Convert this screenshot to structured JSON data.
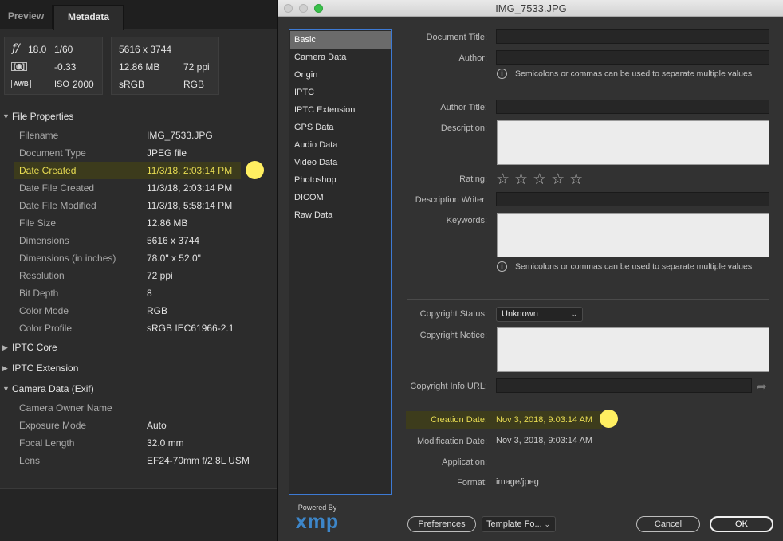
{
  "left_panel": {
    "tabs": [
      "Preview",
      "Metadata"
    ],
    "camera_summary": {
      "aperture_glyph": "f/",
      "aperture": "18.0",
      "shutter": "1/60",
      "metering_glyph": "[◉]",
      "exposure_comp": "-0.33",
      "wb_glyph": "AWB",
      "iso_label": "ISO",
      "iso": "2000"
    },
    "file_summary": {
      "dimensions": "5616 x 3744",
      "size": "12.86 MB",
      "resolution": "72 ppi",
      "color_profile": "sRGB",
      "color_mode": "RGB"
    },
    "sections": {
      "file_properties": "File Properties",
      "iptc_core": "IPTC Core",
      "iptc_extension": "IPTC Extension",
      "camera_data": "Camera Data (Exif)"
    },
    "file_properties": [
      {
        "key": "Filename",
        "value": "IMG_7533.JPG"
      },
      {
        "key": "Document Type",
        "value": "JPEG file"
      },
      {
        "key": "Date Created",
        "value": "11/3/18, 2:03:14 PM"
      },
      {
        "key": "Date File Created",
        "value": "11/3/18, 2:03:14 PM"
      },
      {
        "key": "Date File Modified",
        "value": "11/3/18, 5:58:14 PM"
      },
      {
        "key": "File Size",
        "value": "12.86 MB"
      },
      {
        "key": "Dimensions",
        "value": "5616 x 3744"
      },
      {
        "key": "Dimensions (in inches)",
        "value": "78.0\" x 52.0\""
      },
      {
        "key": "Resolution",
        "value": "72 ppi"
      },
      {
        "key": "Bit Depth",
        "value": "8"
      },
      {
        "key": "Color Mode",
        "value": "RGB"
      },
      {
        "key": "Color Profile",
        "value": "sRGB IEC61966-2.1"
      }
    ],
    "camera_data": [
      {
        "key": "Camera Owner Name",
        "value": ""
      },
      {
        "key": "Exposure Mode",
        "value": "Auto"
      },
      {
        "key": "Focal Length",
        "value": "32.0 mm"
      },
      {
        "key": "Lens",
        "value": "EF24-70mm f/2.8L USM"
      }
    ]
  },
  "dialog": {
    "title": "IMG_7533.JPG",
    "categories": [
      "Basic",
      "Camera Data",
      "Origin",
      "IPTC",
      "IPTC Extension",
      "GPS Data",
      "Audio Data",
      "Video Data",
      "Photoshop",
      "DICOM",
      "Raw Data"
    ],
    "selected_category": "Basic",
    "xmp": {
      "powered_by": "Powered By",
      "logo": "xmp"
    },
    "fields": {
      "document_title": "Document Title:",
      "author": "Author:",
      "author_hint": "Semicolons or commas can be used to separate multiple values",
      "author_title": "Author Title:",
      "description": "Description:",
      "rating": "Rating:",
      "rating_stars": "☆☆☆☆☆",
      "description_writer": "Description Writer:",
      "keywords": "Keywords:",
      "keywords_hint": "Semicolons or commas can be used to separate multiple values",
      "copyright_status": "Copyright Status:",
      "copyright_status_value": "Unknown",
      "copyright_notice": "Copyright Notice:",
      "copyright_url": "Copyright Info URL:",
      "creation_date": "Creation Date:",
      "creation_date_value": "Nov 3, 2018, 9:03:14 AM",
      "modification_date": "Modification Date:",
      "modification_date_value": "Nov 3, 2018, 9:03:14 AM",
      "application": "Application:",
      "application_value": "",
      "format": "Format:",
      "format_value": "image/jpeg"
    },
    "buttons": {
      "preferences": "Preferences",
      "template": "Template Fo...",
      "cancel": "Cancel",
      "ok": "OK"
    }
  },
  "colors": {
    "highlight_text": "#e8dc52",
    "highlight_marker": "#ffef61",
    "selection_border": "#3d7ad4"
  }
}
